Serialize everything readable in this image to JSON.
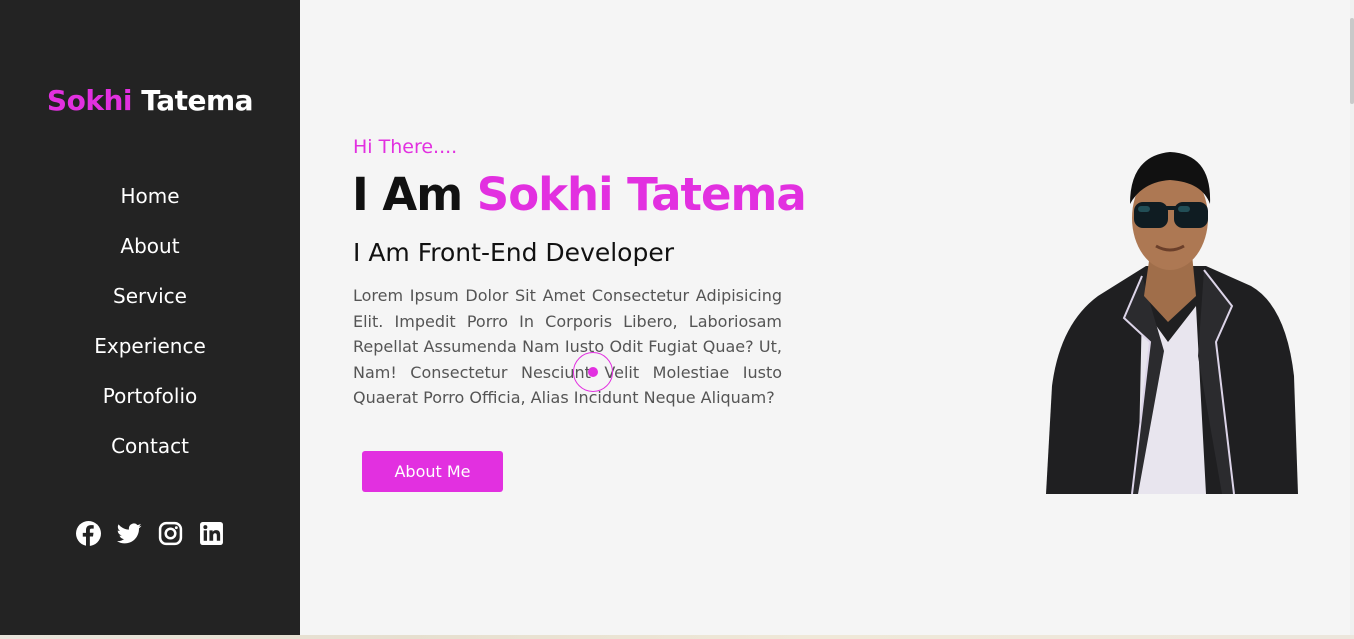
{
  "sidebar": {
    "logo": {
      "first": "Sokhi",
      "last": "Tatema"
    },
    "nav": [
      {
        "label": "Home"
      },
      {
        "label": "About"
      },
      {
        "label": "Service"
      },
      {
        "label": "Experience"
      },
      {
        "label": "Portofolio"
      },
      {
        "label": "Contact"
      }
    ],
    "social": [
      {
        "icon": "facebook-icon"
      },
      {
        "icon": "twitter-icon"
      },
      {
        "icon": "instagram-icon"
      },
      {
        "icon": "linkedin-icon"
      }
    ]
  },
  "hero": {
    "greeting": "Hi There....",
    "headline_prefix": "I Am ",
    "headline_name": "Sokhi Tatema",
    "role": "I Am Front-End Developer",
    "description": "Lorem Ipsum Dolor Sit Amet Consectetur Adipisicing Elit. Impedit Porro In Corporis Libero, Laboriosam Repellat Assumenda Nam Iusto Odit Fugiat Quae? Ut, Nam! Consectetur Nesciunt Velit Molestiae Iusto Quaerat Porro Officia, Alias Incidunt Neque Aliquam?",
    "cta_label": "About Me"
  },
  "colors": {
    "accent": "#e230e0",
    "sidebar_bg": "#232323",
    "page_bg": "#f5f5f5"
  }
}
